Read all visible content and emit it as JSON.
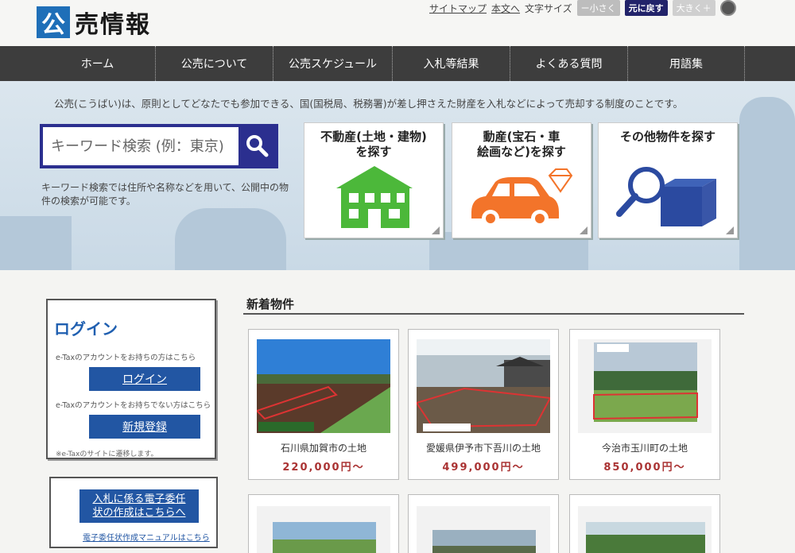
{
  "header": {
    "logo_mark": "公",
    "logo_text": "売情報",
    "sitemap": "サイトマップ",
    "to_body": "本文へ",
    "font_size_label": "文字サイズ",
    "font_small": "ー小さく",
    "font_reset": "元に戻す",
    "font_large": "大きく＋"
  },
  "nav": {
    "items": [
      {
        "label": "ホーム"
      },
      {
        "label": "公売について"
      },
      {
        "label": "公売スケジュール"
      },
      {
        "label": "入札等結果"
      },
      {
        "label": "よくある質問"
      },
      {
        "label": "用語集"
      }
    ]
  },
  "hero": {
    "intro": "公売(こうばい)は、原則としてどなたでも参加できる、国(国税局、税務署)が差し押さえた財産を入札などによって売却する制度のことです。",
    "search_placeholder": "キーワード検索 (例：東京)",
    "search_note": "キーワード検索では住所や名称などを用いて、公開中の物件の検索が可能です。",
    "categories": [
      {
        "line1": "不動産(土地・建物)",
        "line2": "を探す"
      },
      {
        "line1": "動産(宝石・車",
        "line2": "絵画など)を探す"
      },
      {
        "line1": "その他物件を探す",
        "line2": ""
      }
    ]
  },
  "login": {
    "title": "ログイン",
    "have_account": "e-Taxのアカウントをお持ちの方はこちら",
    "login_button": "ログイン",
    "no_account": "e-Taxのアカウントをお持ちでない方はこちら",
    "register_button": "新規登録",
    "note": "※e-Taxのサイトに遷移します。"
  },
  "proxy": {
    "button_line1": "入札に係る電子委任",
    "button_line2": "状の作成はこちらへ",
    "manual_link": "電子委任状作成マニュアルはこちら"
  },
  "new_items": {
    "title": "新着物件",
    "items": [
      {
        "name": "石川県加賀市の土地",
        "price": "220,000円～"
      },
      {
        "name": "愛媛県伊予市下吾川の土地",
        "price": "499,000円～"
      },
      {
        "name": "今治市玉川町の土地",
        "price": "850,000円～"
      }
    ]
  },
  "colors": {
    "brand_blue": "#1f6fb8",
    "nav_bg": "#3d3d3d",
    "button_blue": "#2256a3",
    "price_red": "#aa3333",
    "search_border": "#2b2f8f"
  }
}
